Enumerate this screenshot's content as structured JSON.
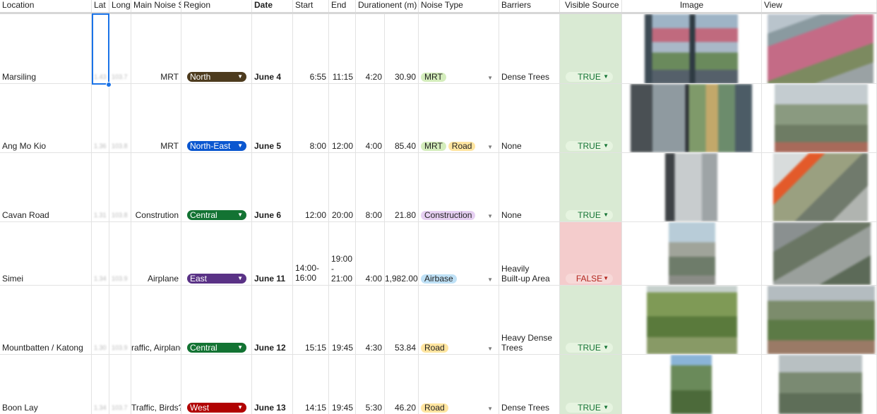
{
  "headers": {
    "location": "Location",
    "lat": "Lat",
    "long": "Long",
    "main_noise": "Main Noise S",
    "region": "Region",
    "date": "Date",
    "start": "Start",
    "end": "End",
    "duration": "Durationent (m)",
    "noise_type": "Noise Type",
    "barriers": "Barriers",
    "visible_source": "Visible Source",
    "image": "Image",
    "view": "View"
  },
  "colors": {
    "region_north": "#4d3b1e",
    "region_northeast": "#0b57d0",
    "region_central": "#137333",
    "region_east": "#5a3286",
    "region_west": "#b10202",
    "chip_mrt": "#d4edbc",
    "chip_road": "#ffe5a0",
    "chip_construction": "#e6cff2",
    "chip_airbase": "#bfe1f6"
  },
  "rows": [
    {
      "location": "Marsiling",
      "lat": "1.43",
      "long": "103.7",
      "main_noise": "MRT",
      "region": "North",
      "date": "June 4",
      "start": "6:55",
      "end": "11:15",
      "duration": "4:20",
      "dur_min": "30.90",
      "noise_types": [
        "MRT"
      ],
      "barriers": "Dense Trees",
      "visible_source": "TRUE"
    },
    {
      "location": "Ang Mo Kio",
      "lat": "1.36",
      "long": "103.8",
      "main_noise": "MRT",
      "region": "North-East",
      "date": "June 5",
      "start": "8:00",
      "end": "12:00",
      "duration": "4:00",
      "dur_min": "85.40",
      "noise_types": [
        "MRT",
        "Road"
      ],
      "barriers": "None",
      "visible_source": "TRUE"
    },
    {
      "location": "Cavan Road",
      "lat": "1.31",
      "long": "103.8",
      "main_noise": "Constrution",
      "region": "Central",
      "date": "June 6",
      "start": "12:00",
      "end": "20:00",
      "duration": "8:00",
      "dur_min": "21.80",
      "noise_types": [
        "Construction"
      ],
      "barriers": "None",
      "visible_source": "TRUE"
    },
    {
      "location": "Simei",
      "lat": "1.34",
      "long": "103.9",
      "main_noise": "Airplane",
      "region": "East",
      "date": "June 11",
      "start": "14:00-\n16:00",
      "end": "19:00\n-\n21:00",
      "duration": "4:00",
      "dur_min": "1,982.00",
      "noise_types": [
        "Airbase"
      ],
      "barriers": "Heavily\nBuilt-up Area",
      "visible_source": "FALSE"
    },
    {
      "location": "Mountbatten / Katong",
      "lat": "1.30",
      "long": "103.9",
      "main_noise": "raffic, Airplane",
      "region": "Central",
      "date": "June 12",
      "start": "15:15",
      "end": "19:45",
      "duration": "4:30",
      "dur_min": "53.84",
      "noise_types": [
        "Road"
      ],
      "barriers": "Heavy Dense\nTrees",
      "visible_source": "TRUE"
    },
    {
      "location": "Boon Lay",
      "lat": "1.34",
      "long": "103.7",
      "main_noise": "Traffic, Birds?",
      "region": "West",
      "date": "June 13",
      "start": "14:15",
      "end": "19:45",
      "duration": "5:30",
      "dur_min": "46.20",
      "noise_types": [
        "Road"
      ],
      "barriers": "Dense Trees",
      "visible_source": "TRUE"
    }
  ]
}
